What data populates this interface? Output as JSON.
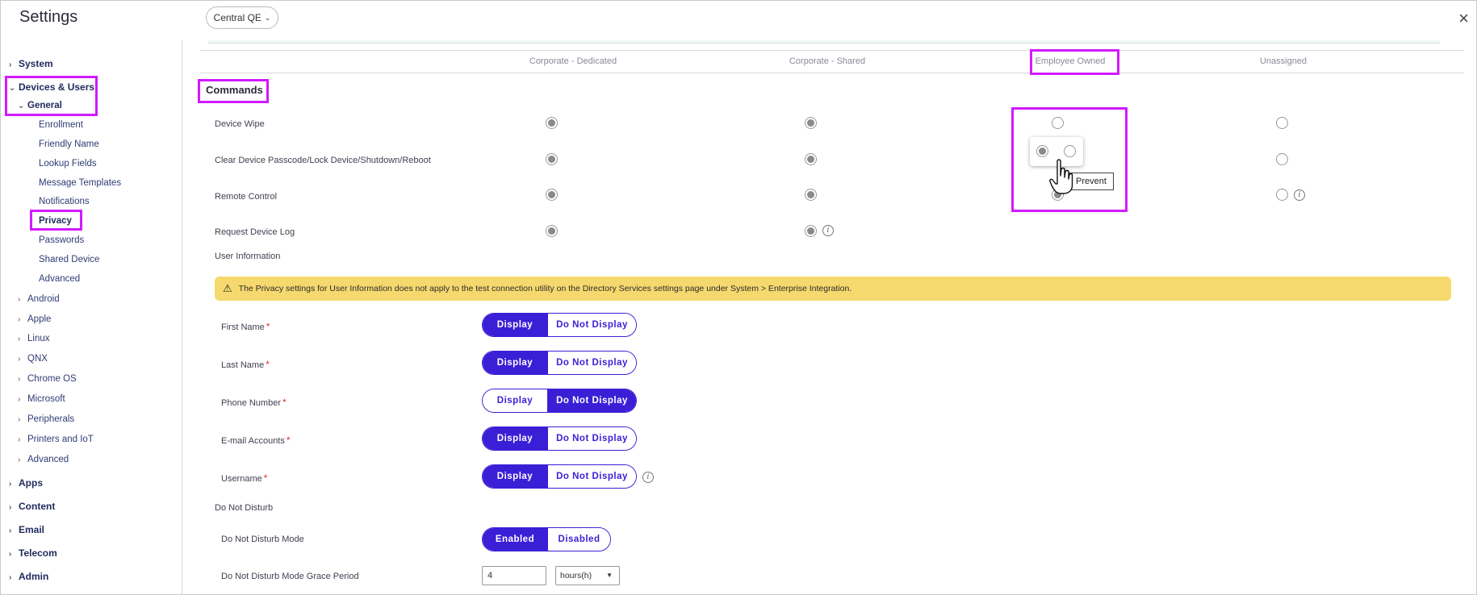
{
  "header": {
    "title": "Settings",
    "tenant": "Central QE",
    "close": "×"
  },
  "sidebar": {
    "system": "System",
    "devices_users": "Devices & Users",
    "general": "General",
    "general_items": [
      "Enrollment",
      "Friendly Name",
      "Lookup Fields",
      "Message Templates",
      "Notifications",
      "Privacy",
      "Passwords",
      "Shared Device",
      "Advanced"
    ],
    "platforms": [
      "Android",
      "Apple",
      "Linux",
      "QNX",
      "Chrome OS",
      "Microsoft",
      "Peripherals",
      "Printers and IoT",
      "Advanced"
    ],
    "bottom": [
      "Apps",
      "Content",
      "Email",
      "Telecom",
      "Admin"
    ]
  },
  "columns": [
    "Corporate - Dedicated",
    "Corporate - Shared",
    "Employee Owned",
    "Unassigned"
  ],
  "commands": {
    "title": "Commands",
    "rows": [
      {
        "label": "Device Wipe"
      },
      {
        "label": "Clear Device Passcode/Lock Device/Shutdown/Reboot"
      },
      {
        "label": "Remote Control"
      },
      {
        "label": "Request Device Log"
      }
    ],
    "popup_tooltip": "Prevent"
  },
  "user_info": {
    "title": "User Information",
    "banner": "The Privacy settings for User Information does not apply to the test connection utility on the Directory Services settings page under System > Enterprise Integration.",
    "display_label": "Display",
    "not_display_label": "Do Not Display",
    "fields": [
      {
        "label": "First Name",
        "selected": "Display"
      },
      {
        "label": "Last Name",
        "selected": "Display"
      },
      {
        "label": "Phone Number",
        "selected": "Do Not Display"
      },
      {
        "label": "E-mail Accounts",
        "selected": "Display"
      },
      {
        "label": "Username",
        "selected": "Display"
      }
    ]
  },
  "dnd": {
    "title": "Do Not Disturb",
    "mode_label": "Do Not Disturb Mode",
    "enabled": "Enabled",
    "disabled": "Disabled",
    "selected": "Enabled",
    "grace_label": "Do Not Disturb Mode Grace Period",
    "grace_value": "4",
    "grace_unit": "hours(h)"
  },
  "colors": {
    "accent": "#3b1fd6",
    "highlight": "#d21aff",
    "banner": "#f6d96e"
  }
}
